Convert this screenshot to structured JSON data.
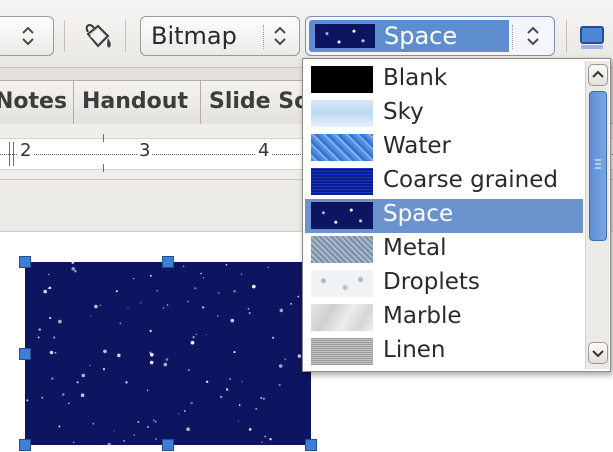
{
  "toolbar": {
    "area_style_combo": {
      "value": "Bitmap"
    },
    "bitmap_combo": {
      "value": "Space",
      "swatch": "space"
    }
  },
  "tabs": [
    {
      "label": "Notes"
    },
    {
      "label": "Handout"
    },
    {
      "label": "Slide Sorter"
    }
  ],
  "ruler": {
    "numbers": [
      "2",
      "3",
      "4"
    ]
  },
  "bitmap_list": {
    "selected_index": 4,
    "items": [
      {
        "label": "Blank",
        "swatch": "blank"
      },
      {
        "label": "Sky",
        "swatch": "sky"
      },
      {
        "label": "Water",
        "swatch": "water"
      },
      {
        "label": "Coarse grained",
        "swatch": "coarse"
      },
      {
        "label": "Space",
        "swatch": "space"
      },
      {
        "label": "Metal",
        "swatch": "metal"
      },
      {
        "label": "Droplets",
        "swatch": "droplets"
      },
      {
        "label": "Marble",
        "swatch": "marble"
      },
      {
        "label": "Linen",
        "swatch": "linen"
      }
    ],
    "scroll_position": 0
  },
  "colors": {
    "selection": "#6b94cf",
    "space_fill": "#0d1560",
    "handle": "#3d7fd6"
  },
  "icons": [
    "spin-arrows-icon",
    "paint-bucket-icon",
    "chevron-up-icon",
    "chevron-down-icon",
    "fill-color-icon"
  ]
}
